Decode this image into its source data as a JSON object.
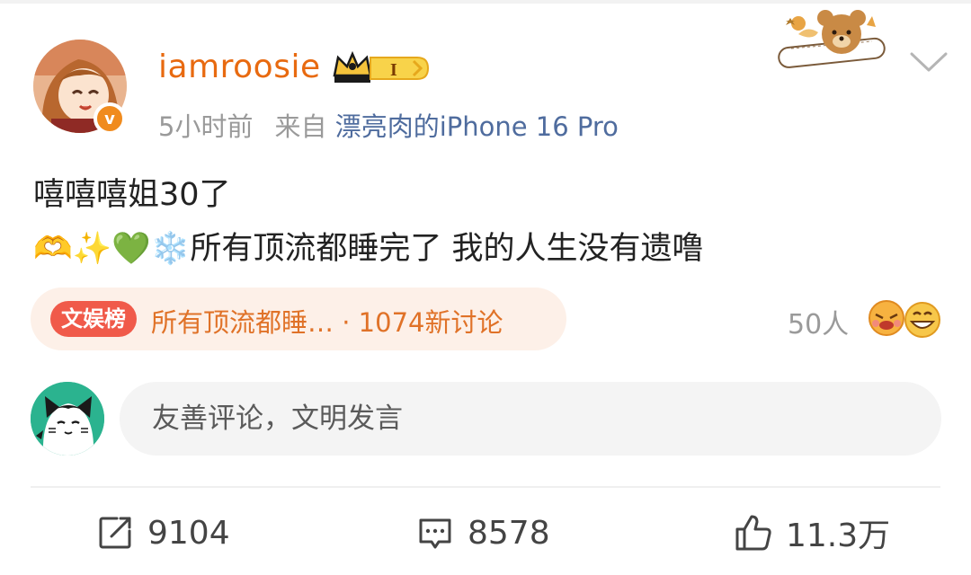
{
  "post": {
    "username": "iamroosie",
    "vip_level": "I",
    "time": "5小时前",
    "source_prefix": "来自",
    "device": "漂亮肉的iPhone 16 Pro",
    "text_line1": "嘻嘻嘻姐30了",
    "text_line2": "🫶✨💚❄️所有顶流都睡完了 我的人生没有遗噜"
  },
  "topic": {
    "tag": "文娱榜",
    "title": "所有顶流都睡…",
    "separator": "·",
    "discussion": "1074新讨论"
  },
  "reactions": {
    "count": "50人"
  },
  "comment_box": {
    "placeholder": "友善评论，文明发言"
  },
  "actions": {
    "share_count": "9104",
    "comment_count": "8578",
    "like_count": "11.3万"
  },
  "icons": {
    "verified": "v-badge-icon",
    "vip": "crown-vip-icon",
    "more": "chevron-down-icon",
    "share": "share-icon",
    "comment": "comment-icon",
    "like": "thumbs-up-icon"
  },
  "colors": {
    "username": "#e86a10",
    "device": "#4f6c9e",
    "topic_text": "#e07228",
    "topic_tag_bg": "#f05a4a",
    "verified": "#f08b1e"
  }
}
